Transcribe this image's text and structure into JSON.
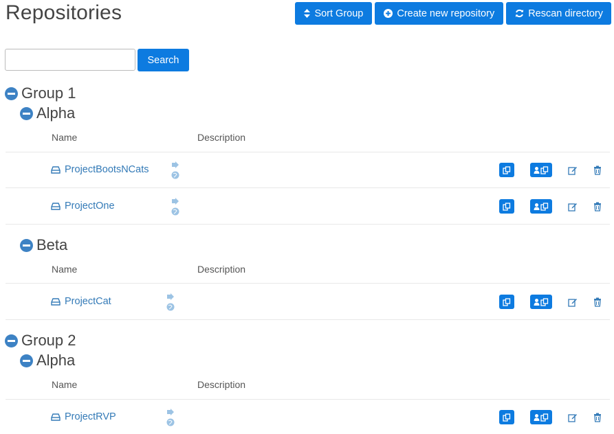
{
  "page": {
    "title": "Repositories"
  },
  "toolbar": {
    "sort_label": "Sort Group",
    "create_label": "Create new repository",
    "rescan_label": "Rescan directory"
  },
  "search": {
    "value": "",
    "placeholder": "",
    "button_label": "Search"
  },
  "columns": {
    "name": "Name",
    "description": "Description"
  },
  "groups": [
    {
      "name": "Group 1",
      "subgroups": [
        {
          "name": "Alpha",
          "repos": [
            {
              "name": "ProjectBootsNCats",
              "description": ""
            },
            {
              "name": "ProjectOne",
              "description": ""
            }
          ]
        },
        {
          "name": "Beta",
          "repos": [
            {
              "name": "ProjectCat",
              "description": ""
            }
          ]
        }
      ]
    },
    {
      "name": "Group 2",
      "subgroups": [
        {
          "name": "Alpha",
          "repos": [
            {
              "name": "ProjectRVP",
              "description": ""
            }
          ]
        }
      ]
    }
  ],
  "colors": {
    "primary": "#0d7be0",
    "link": "#337ab7",
    "collapse": "#3d82c4",
    "muted_icon": "#9cc3e4"
  }
}
